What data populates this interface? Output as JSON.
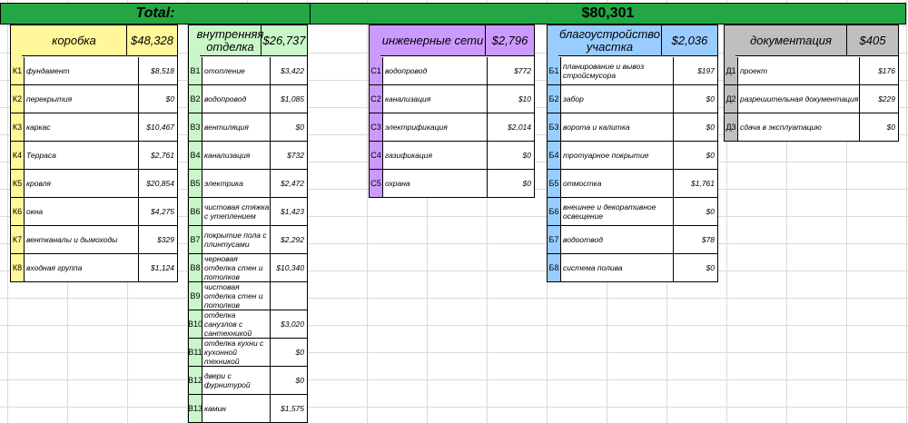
{
  "header": {
    "total_label": "Total:",
    "total_value": "$80,301"
  },
  "categories": [
    {
      "name": "коробка",
      "total": "$48,328",
      "color": "#fff799",
      "rows": [
        {
          "code": "К1",
          "label": "фундамент",
          "value": "$8,518"
        },
        {
          "code": "К2",
          "label": "перекрытия",
          "value": "$0"
        },
        {
          "code": "К3",
          "label": "каркас",
          "value": "$10,467"
        },
        {
          "code": "К4",
          "label": "Терраса",
          "value": "$2,761"
        },
        {
          "code": "К5",
          "label": "кровля",
          "value": "$20,854"
        },
        {
          "code": "К6",
          "label": "окна",
          "value": "$4,275"
        },
        {
          "code": "К7",
          "label": "вентканалы и дымоходы",
          "value": "$329"
        },
        {
          "code": "К8",
          "label": "входная группа",
          "value": "$1,124"
        }
      ]
    },
    {
      "name": "внутренняя отделка",
      "total": "$26,737",
      "color": "#c9f7c9",
      "rows": [
        {
          "code": "В1",
          "label": "отопление",
          "value": "$3,422"
        },
        {
          "code": "В2",
          "label": "водопровод",
          "value": "$1,085"
        },
        {
          "code": "В3",
          "label": "вентиляция",
          "value": "$0"
        },
        {
          "code": "В4",
          "label": "канализация",
          "value": "$732"
        },
        {
          "code": "В5",
          "label": "электрика",
          "value": "$2,472"
        },
        {
          "code": "В6",
          "label": "чистовая стяжка с утеплением",
          "value": "$1,423"
        },
        {
          "code": "В7",
          "label": "покрытие пола с плинтусами",
          "value": "$2,292"
        },
        {
          "code": "В8",
          "label": "черновая отделка стен и потолков",
          "value": "$10,340"
        },
        {
          "code": "В9",
          "label": "чистовая отделка стен и потолков",
          "value": ""
        },
        {
          "code": "В10",
          "label": "отделка санузлов с сантехникой",
          "value": "$3,020"
        },
        {
          "code": "В11",
          "label": "отделка кухни с кухонной техникой",
          "value": "$0"
        },
        {
          "code": "В12",
          "label": "двери с фурнитурой",
          "value": "$0"
        },
        {
          "code": "В13",
          "label": "камин",
          "value": "$1,575"
        }
      ]
    },
    {
      "name": "инженерные сети",
      "total": "$2,796",
      "color": "#cc99ff",
      "rows": [
        {
          "code": "С1",
          "label": "водопровод",
          "value": "$772"
        },
        {
          "code": "С2",
          "label": "канализация",
          "value": "$10"
        },
        {
          "code": "С3",
          "label": "электрификация",
          "value": "$2,014"
        },
        {
          "code": "С4",
          "label": "газификация",
          "value": "$0"
        },
        {
          "code": "С5",
          "label": "охрана",
          "value": "$0"
        }
      ]
    },
    {
      "name": "благоустройство участка",
      "total": "$2,036",
      "color": "#99ccff",
      "rows": [
        {
          "code": "Б1",
          "label": "планирование и вывоз стройсмусора",
          "value": "$197"
        },
        {
          "code": "Б2",
          "label": "забор",
          "value": "$0"
        },
        {
          "code": "Б3",
          "label": "ворота и калитка",
          "value": "$0"
        },
        {
          "code": "Б4",
          "label": "тротуарное покрытие",
          "value": "$0"
        },
        {
          "code": "Б5",
          "label": "отмостка",
          "value": "$1,761"
        },
        {
          "code": "Б6",
          "label": "внешнее и декоративное освещение",
          "value": "$0"
        },
        {
          "code": "Б7",
          "label": "водоотвод",
          "value": "$78"
        },
        {
          "code": "Б8",
          "label": "система полива",
          "value": "$0"
        }
      ]
    },
    {
      "name": "документация",
      "total": "$405",
      "color": "#bfbfbf",
      "rows": [
        {
          "code": "Д1",
          "label": "проект",
          "value": "$176"
        },
        {
          "code": "Д2",
          "label": "разрешительная документация",
          "value": "$229"
        },
        {
          "code": "Д3",
          "label": "сдача в эксплуатацию",
          "value": "$0"
        }
      ]
    }
  ]
}
